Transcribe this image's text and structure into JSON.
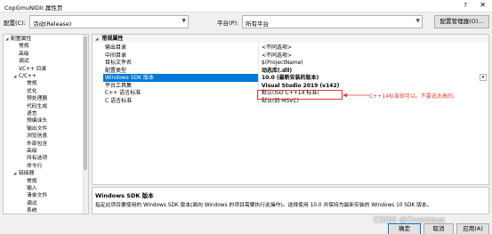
{
  "window": {
    "title": "CopGmuNIDII 属性页",
    "help": "?",
    "close": "✕"
  },
  "toolbar": {
    "config_label": "配置(C):",
    "config_value": "活动(Release)",
    "platform_label": "平台(P):",
    "platform_value": "所有平台",
    "config_manager": "配置管理器(O)..."
  },
  "tree": {
    "items": [
      {
        "label": "配置属性",
        "indent": 0,
        "toggle": "◢"
      },
      {
        "label": "常规",
        "indent": 1,
        "toggle": ""
      },
      {
        "label": "高级",
        "indent": 1,
        "toggle": ""
      },
      {
        "label": "调试",
        "indent": 1,
        "toggle": ""
      },
      {
        "label": "VC++ 目录",
        "indent": 1,
        "toggle": ""
      },
      {
        "label": "C/C++",
        "indent": 1,
        "toggle": "◢"
      },
      {
        "label": "常规",
        "indent": 2,
        "toggle": ""
      },
      {
        "label": "优化",
        "indent": 2,
        "toggle": ""
      },
      {
        "label": "预处理器",
        "indent": 2,
        "toggle": ""
      },
      {
        "label": "代码生成",
        "indent": 2,
        "toggle": ""
      },
      {
        "label": "语言",
        "indent": 2,
        "toggle": ""
      },
      {
        "label": "预编译头",
        "indent": 2,
        "toggle": ""
      },
      {
        "label": "输出文件",
        "indent": 2,
        "toggle": ""
      },
      {
        "label": "浏览信息",
        "indent": 2,
        "toggle": ""
      },
      {
        "label": "外部包含",
        "indent": 2,
        "toggle": ""
      },
      {
        "label": "高级",
        "indent": 2,
        "toggle": ""
      },
      {
        "label": "所有选项",
        "indent": 2,
        "toggle": ""
      },
      {
        "label": "命令行",
        "indent": 2,
        "toggle": ""
      },
      {
        "label": "链接器",
        "indent": 1,
        "toggle": "◢"
      },
      {
        "label": "常规",
        "indent": 2,
        "toggle": ""
      },
      {
        "label": "输入",
        "indent": 2,
        "toggle": ""
      },
      {
        "label": "清单文件",
        "indent": 2,
        "toggle": ""
      },
      {
        "label": "调试",
        "indent": 2,
        "toggle": ""
      },
      {
        "label": "系统",
        "indent": 2,
        "toggle": ""
      }
    ]
  },
  "grid": {
    "category": "常规属性",
    "category_toggle": "◢",
    "rows": [
      {
        "name": "输出目录",
        "value": "<不同选项>",
        "bold": false,
        "selected": false
      },
      {
        "name": "中间目录",
        "value": "<不同选项>",
        "bold": false,
        "selected": false
      },
      {
        "name": "目标文件名",
        "value": "$(ProjectName)",
        "bold": false,
        "selected": false
      },
      {
        "name": "配置类型",
        "value": "动态库(.dll)",
        "bold": true,
        "selected": false
      },
      {
        "name": "Windows SDK 版本",
        "value": "10.0 (最新安装的版本)",
        "bold": true,
        "selected": true
      },
      {
        "name": "平台工具集",
        "value": "Visual Studio 2019 (v142)",
        "bold": true,
        "selected": false
      },
      {
        "name": "C++ 语言标准",
        "value": "默认(ISO C++14 标准)",
        "bold": false,
        "selected": false
      },
      {
        "name": "C 语言标准",
        "value": "默认(旧 MSVC)",
        "bold": false,
        "selected": false
      }
    ],
    "dropdown_arrow": "▾"
  },
  "annotation": {
    "text": "C++14标准就可以。不要选太高的。",
    "color": "#e53935"
  },
  "description": {
    "title": "Windows SDK 版本",
    "text": "指定此项目要使用的 Windows SDK 版本(面向 Windows 的项目需要执行此操作)。选择使用 10.0 并保持为最新安装的 Windows 10 SDK 版本。"
  },
  "footer": {
    "ok": "确定",
    "cancel": "取消",
    "apply": "应用(A)"
  },
  "watermark": "CSDN @Overzeus",
  "colors": {
    "accent": "#0078d7",
    "annotation": "#e53935"
  }
}
